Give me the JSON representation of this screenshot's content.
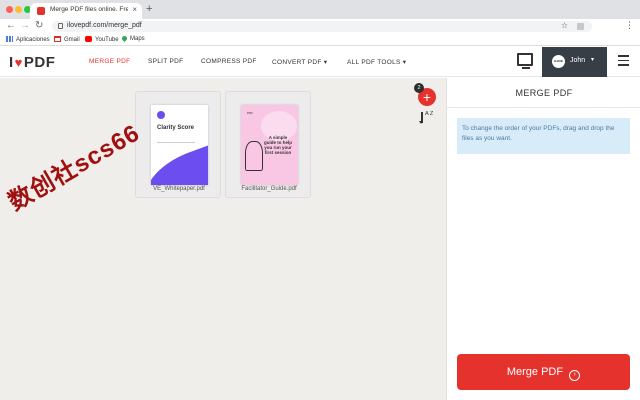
{
  "browser": {
    "tab_title": "Merge PDF files online. Free serv",
    "tab_close": "×",
    "new_tab": "+",
    "url": "ilovepdf.com/merge_pdf",
    "back": "←",
    "forward": "→",
    "reload": "↻",
    "star": "☆",
    "menu": "⋮",
    "bookmarks": [
      {
        "label": "Aplicaciones",
        "icon": "apps-icon"
      },
      {
        "label": "Gmail",
        "icon": "gmail-icon"
      },
      {
        "label": "YouTube",
        "icon": "youtube-icon"
      },
      {
        "label": "Maps",
        "icon": "maps-icon"
      }
    ]
  },
  "header": {
    "logo_left": "I",
    "logo_heart": "♥",
    "logo_right": "PDF",
    "nav": [
      {
        "label": "MERGE PDF",
        "active": true
      },
      {
        "label": "SPLIT PDF",
        "active": false
      },
      {
        "label": "COMPRESS PDF",
        "active": false
      },
      {
        "label": "CONVERT PDF ▾",
        "active": false
      },
      {
        "label": "ALL PDF TOOLS ▾",
        "active": false
      }
    ],
    "user": {
      "avatar_text": "ILOVE",
      "name": "John",
      "caret": "▾"
    }
  },
  "workspace": {
    "files": [
      {
        "name": "VE_Whitepaper.pdf",
        "doc_title": "Clarity Score"
      },
      {
        "name": "Facilitator_Guide.pdf",
        "doc_label": "PDF",
        "doc_title": "A simple guide to help you run your first session"
      }
    ],
    "file_count": "2",
    "add_symbol": "+",
    "sort_label": "A Z",
    "watermark": "数创社scs66"
  },
  "sidebar": {
    "title": "MERGE PDF",
    "info": "To change the order of your PDFs, drag and drop the files as you want.",
    "merge_button": "Merge PDF",
    "merge_arrow": "›"
  },
  "colors": {
    "accent": "#e5322d",
    "info_bg": "#d8ebf8",
    "user_bg": "#383e45"
  }
}
